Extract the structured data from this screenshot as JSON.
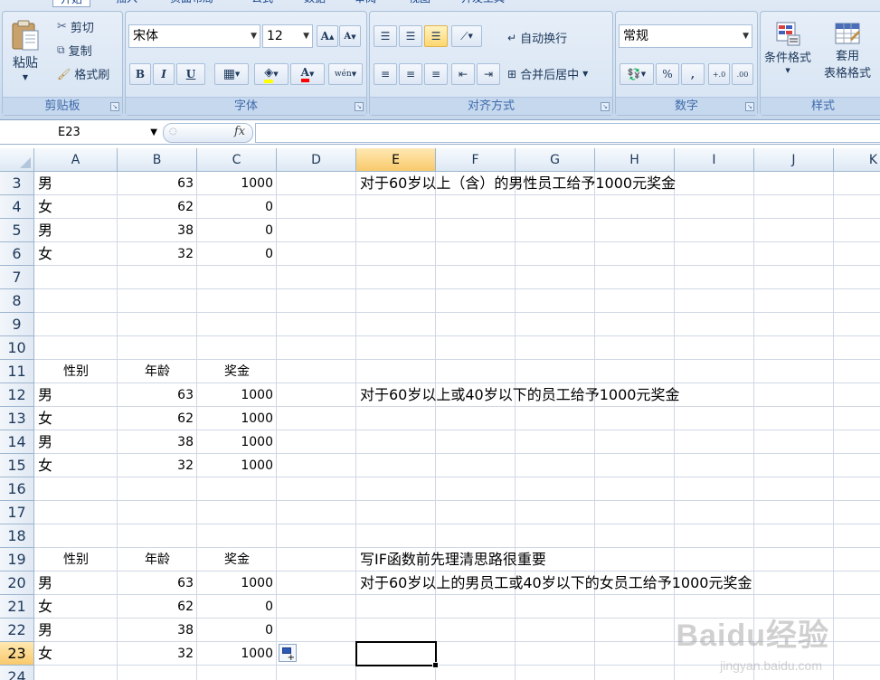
{
  "ribbon": {
    "tabs": [
      "开始",
      "插入",
      "页面布局",
      "公式",
      "数据",
      "审阅",
      "视图",
      "开发工具"
    ],
    "clipboard": {
      "paste": "粘贴",
      "cut": "剪切",
      "copy": "复制",
      "format_painter": "格式刷",
      "label": "剪贴板"
    },
    "font": {
      "name": "宋体",
      "size": "12",
      "grow": "A",
      "shrink": "A",
      "bold": "B",
      "italic": "I",
      "underline": "U",
      "font_color": "A",
      "phonetic": "wén",
      "label": "字体"
    },
    "alignment": {
      "wrap_text": "自动换行",
      "merge_center": "合并后居中",
      "label": "对齐方式"
    },
    "number": {
      "format": "常规",
      "percent": "%",
      "comma": ",",
      "inc_decimal": "+.0",
      "dec_decimal": ".00",
      "label": "数字"
    },
    "styles": {
      "conditional": "条件格式",
      "table_format_1": "套用",
      "table_format_2": "表格格式",
      "label": "样式"
    }
  },
  "formula_bar": {
    "name_box": "E23",
    "fx": "fx",
    "formula": ""
  },
  "grid": {
    "columns": [
      "A",
      "B",
      "C",
      "D",
      "E",
      "F",
      "G",
      "H",
      "I",
      "J",
      "K"
    ],
    "rows": [
      "3",
      "4",
      "5",
      "6",
      "7",
      "8",
      "9",
      "10",
      "11",
      "12",
      "13",
      "14",
      "15",
      "16",
      "17",
      "18",
      "19",
      "20",
      "21",
      "22",
      "23",
      "24"
    ],
    "selected_cell": "E23",
    "cells": {
      "r3": {
        "A": "男",
        "B": "63",
        "C": "1000",
        "E": "对于60岁以上（含）的男性员工给予1000元奖金"
      },
      "r4": {
        "A": "女",
        "B": "62",
        "C": "0"
      },
      "r5": {
        "A": "男",
        "B": "38",
        "C": "0"
      },
      "r6": {
        "A": "女",
        "B": "32",
        "C": "0"
      },
      "r11": {
        "A": "性别",
        "B": "年龄",
        "C": "奖金"
      },
      "r12": {
        "A": "男",
        "B": "63",
        "C": "1000",
        "E": "对于60岁以上或40岁以下的员工给予1000元奖金"
      },
      "r13": {
        "A": "女",
        "B": "62",
        "C": "1000"
      },
      "r14": {
        "A": "男",
        "B": "38",
        "C": "1000"
      },
      "r15": {
        "A": "女",
        "B": "32",
        "C": "1000"
      },
      "r19": {
        "A": "性别",
        "B": "年龄",
        "C": "奖金",
        "E": "写IF函数前先理清思路很重要"
      },
      "r20": {
        "A": "男",
        "B": "63",
        "C": "1000",
        "E": "对于60岁以上的男员工或40岁以下的女员工给予1000元奖金"
      },
      "r21": {
        "A": "女",
        "B": "62",
        "C": "0"
      },
      "r22": {
        "A": "男",
        "B": "38",
        "C": "0"
      },
      "r23": {
        "A": "女",
        "B": "32",
        "C": "1000"
      }
    }
  },
  "watermark": {
    "brand": "Baidu经验",
    "url": "jingyan.baidu.com"
  }
}
